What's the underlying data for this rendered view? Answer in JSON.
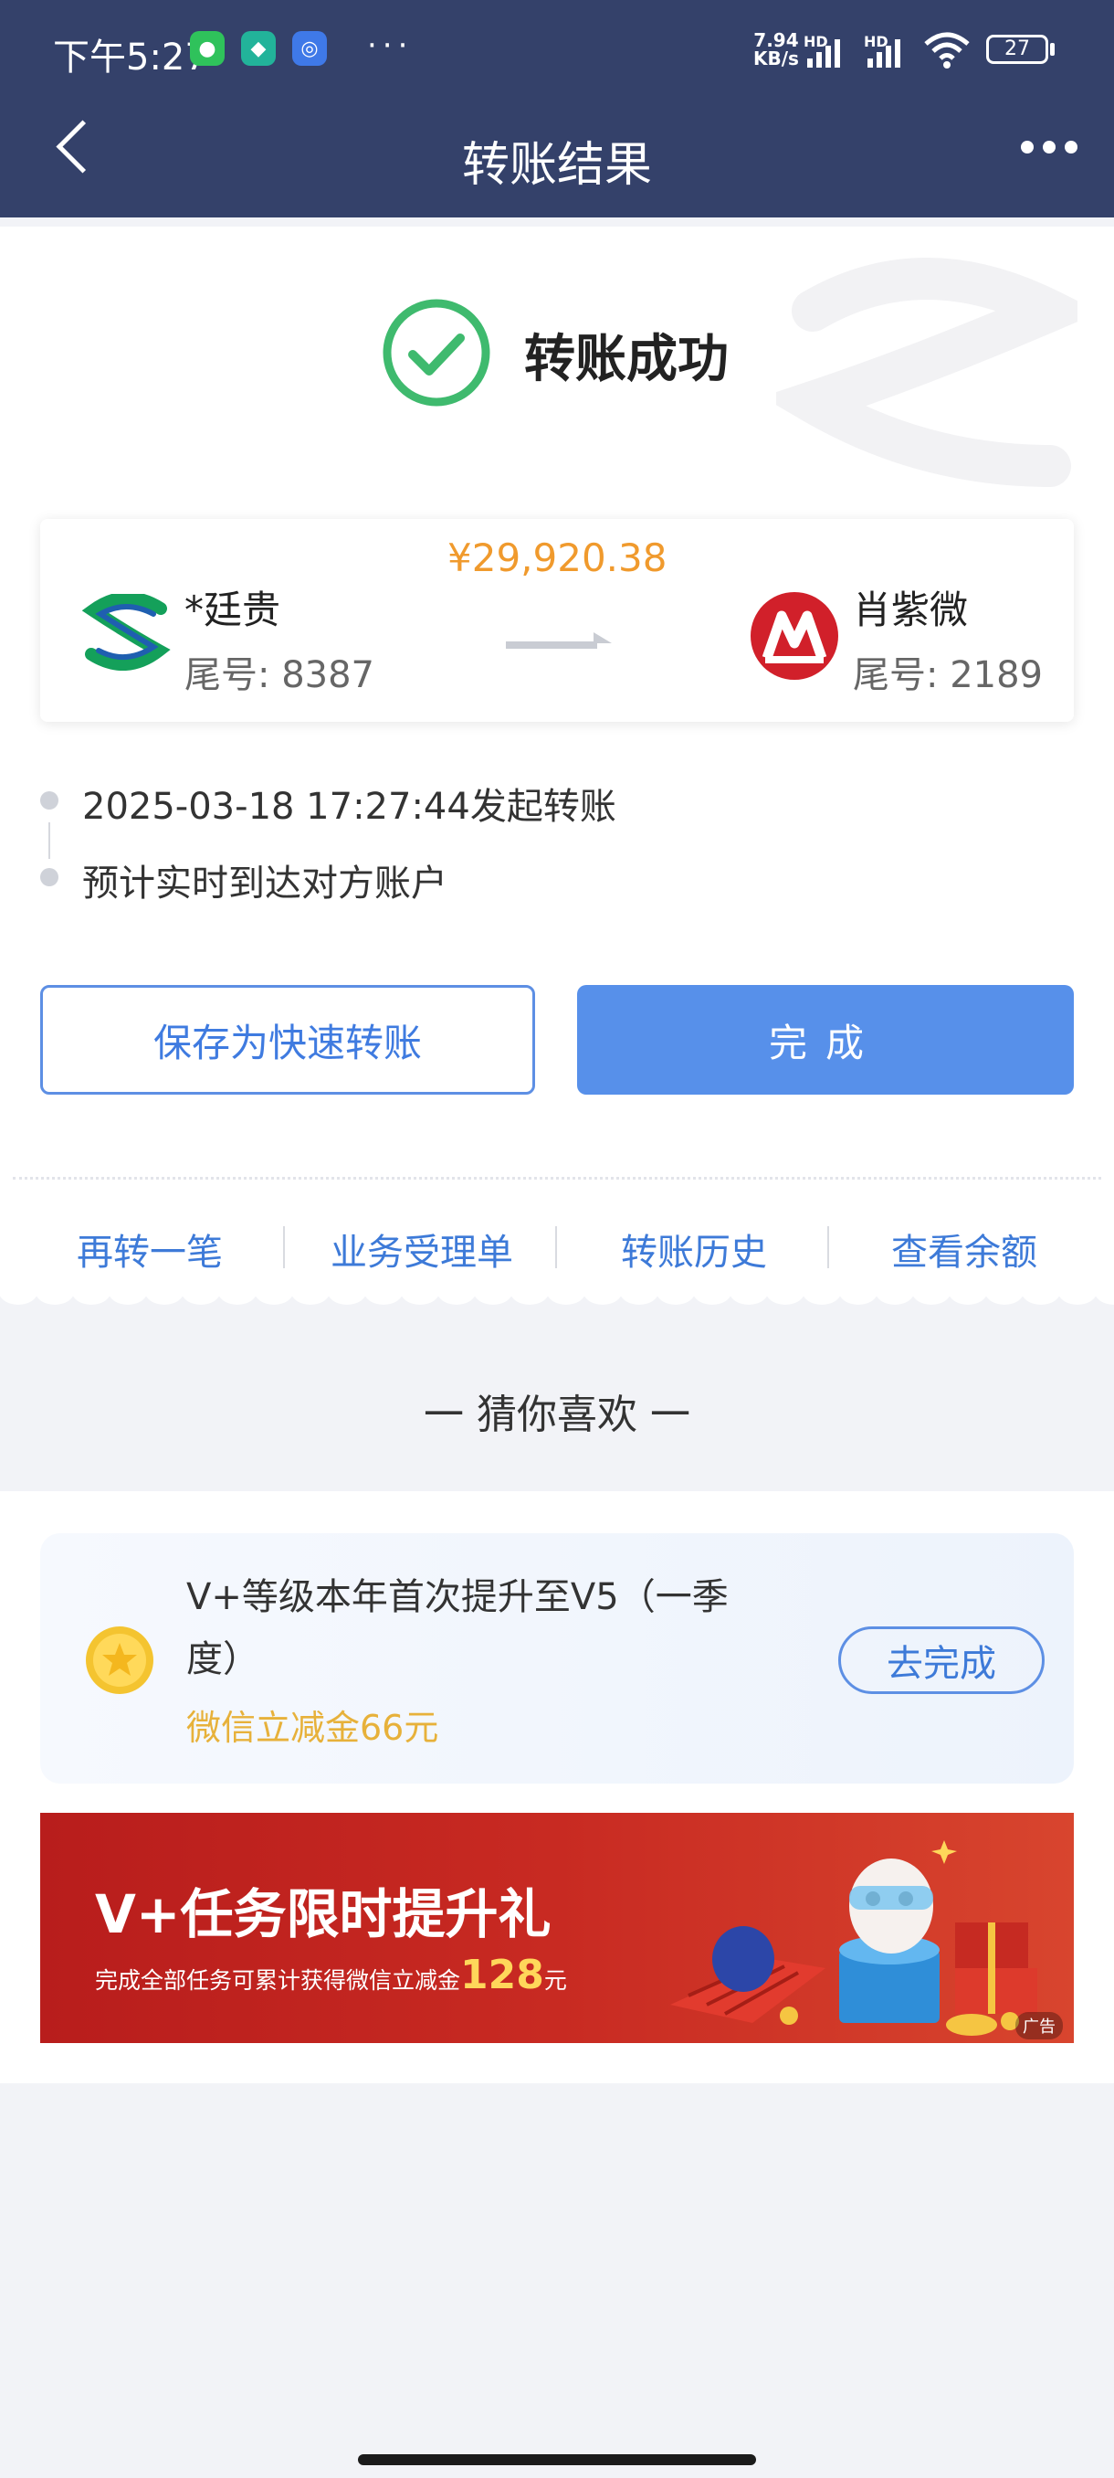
{
  "status_bar": {
    "time": "下午5:27",
    "net_speed_value": "7.94",
    "net_speed_unit": "KB/s",
    "sig1": "HD",
    "sig2": "HD",
    "battery": "27"
  },
  "header": {
    "title": "转账结果"
  },
  "result": {
    "status_text": "转账成功",
    "amount": "¥29,920.38",
    "sender": {
      "name": "*廷贵",
      "account_no": "尾号: 8387"
    },
    "receiver": {
      "name": "肖紫微",
      "account_no": "尾号: 2189"
    }
  },
  "timeline": [
    {
      "text": "2025-03-18 17:27:44发起转账"
    },
    {
      "text": "预计实时到达对方账户"
    }
  ],
  "buttons": {
    "save_quick": "保存为快速转账",
    "done": "完成"
  },
  "links": [
    "再转一笔",
    "业务受理单",
    "转账历史",
    "查看余额"
  ],
  "recommend": {
    "heading": "一 猜你喜欢 一",
    "task": {
      "title": "V+等级本年首次提升至V5（一季度）",
      "reward": "微信立减金66元",
      "button": "去完成"
    },
    "banner": {
      "title": "V+任务限时提升礼",
      "subtitle": "完成全部任务可累计获得微信立减金",
      "amount": "128",
      "unit": "元",
      "ad_label": "广告"
    }
  },
  "colors": {
    "nav_bg": "#34416a",
    "primary": "#5790ea",
    "amount": "#f09a2d",
    "success": "#3fba6e",
    "reward": "#e7b13a"
  }
}
